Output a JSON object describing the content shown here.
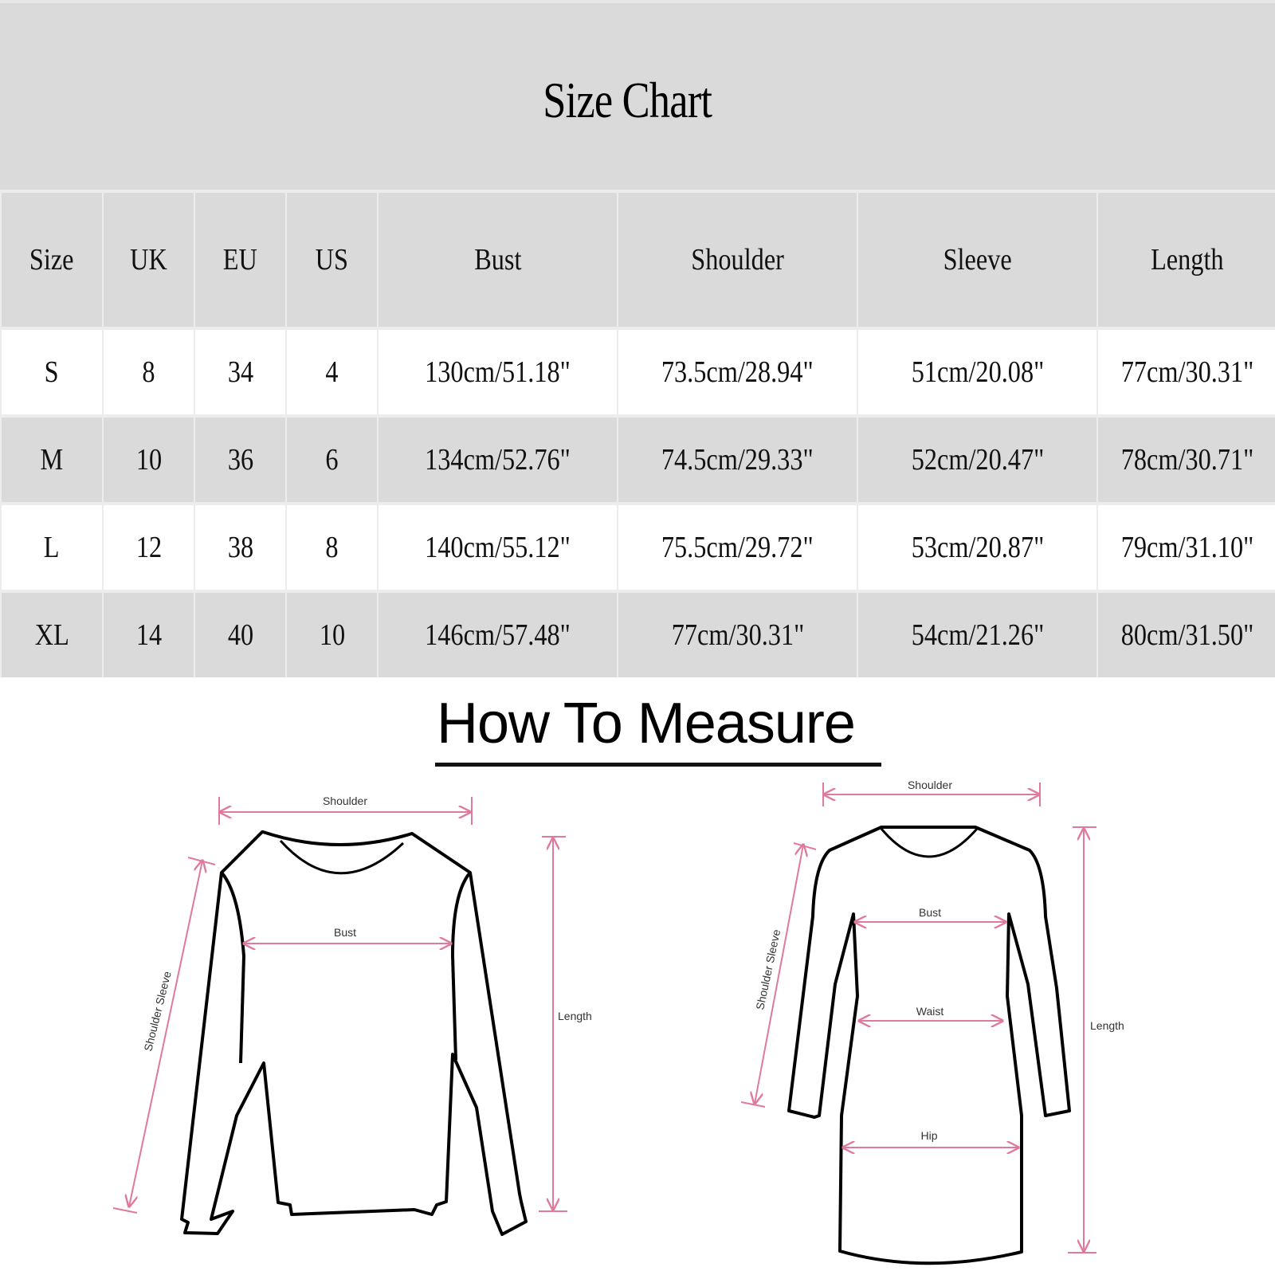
{
  "title": "Size Chart",
  "table": {
    "headers": [
      "Size",
      "UK",
      "EU",
      "US",
      "Bust",
      "Shoulder",
      "Sleeve",
      "Length"
    ],
    "rows": [
      [
        "S",
        "8",
        "34",
        "4",
        "130cm/51.18\"",
        "73.5cm/28.94\"",
        "51cm/20.08\"",
        "77cm/30.31\""
      ],
      [
        "M",
        "10",
        "36",
        "6",
        "134cm/52.76\"",
        "74.5cm/29.33\"",
        "52cm/20.47\"",
        "78cm/30.71\""
      ],
      [
        "L",
        "12",
        "38",
        "8",
        "140cm/55.12\"",
        "75.5cm/29.72\"",
        "53cm/20.87\"",
        "79cm/31.10\""
      ],
      [
        "XL",
        "14",
        "40",
        "10",
        "146cm/57.48\"",
        "77cm/30.31\"",
        "54cm/21.26\"",
        "80cm/31.50\""
      ]
    ]
  },
  "how_to_measure": {
    "title": "How To Measure",
    "sweatshirt": {
      "shoulder": "Shoulder",
      "bust": "Bust",
      "sleeve": "Shoulder Sleeve",
      "length": "Length"
    },
    "dress": {
      "shoulder": "Shoulder",
      "bust": "Bust",
      "waist": "Waist",
      "hip": "Hip",
      "sleeve": "Shoulder Sleeve",
      "length": "Length"
    }
  },
  "colors": {
    "header_bg": "#dadada",
    "measure_line": "#e07a9a",
    "outline": "#000000"
  }
}
